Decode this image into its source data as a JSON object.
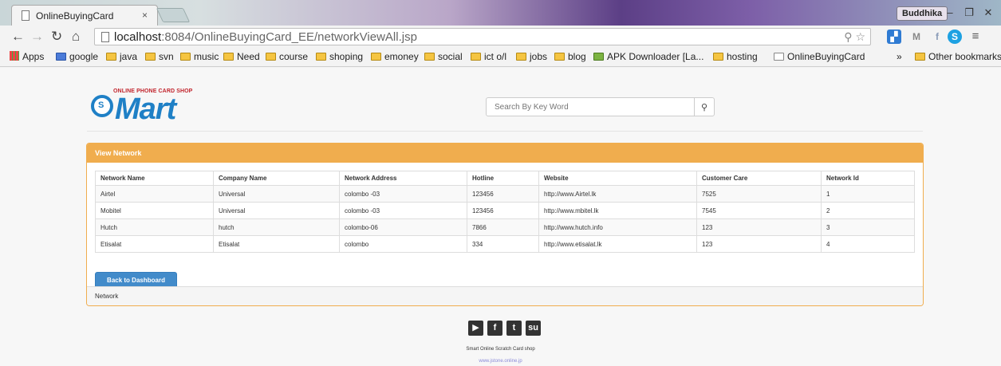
{
  "browser": {
    "tab_title": "OnlineBuyingCard",
    "tab_close": "×",
    "profile_name": "Buddhika",
    "url_host": "localhost",
    "url_rest": ":8084/OnlineBuyingCard_EE/networkViewAll.jsp",
    "bookmarks": [
      "Apps",
      "google",
      "java",
      "svn",
      "music",
      "Need",
      "course",
      "shoping",
      "emoney",
      "social",
      "ict o/l",
      "jobs",
      "blog",
      "APK Downloader [La...",
      "hosting",
      "OnlineBuyingCard"
    ],
    "bookmarks_more": "»",
    "other_bookmarks": "Other bookmarks"
  },
  "logo": {
    "tagline": "ONLINE PHONE CARD SHOP",
    "word": "Mart",
    "circle_letter": "S"
  },
  "search": {
    "placeholder": "Search By Key Word",
    "button_icon": "search-icon"
  },
  "panel": {
    "heading": "View Network",
    "columns": [
      "Network Name",
      "Company Name",
      "Network Address",
      "Hotline",
      "Website",
      "Customer Care",
      "Network Id"
    ],
    "rows": [
      [
        "Airtel",
        "Universal",
        "colombo -03",
        "123456",
        "http://www.Airtel.lk",
        "7525",
        "1"
      ],
      [
        "Mobitel",
        "Universal",
        "colombo -03",
        "123456",
        "http://www.mbitel.lk",
        "7545",
        "2"
      ],
      [
        "Hutch",
        "hutch",
        "colombo-06",
        "7866",
        "http://www.hutch.info",
        "123",
        "3"
      ],
      [
        "Etisalat",
        "Etisalat",
        "colombo",
        "334",
        "http://www.etisalat.lk",
        "123",
        "4"
      ]
    ],
    "back_button": "Back to Dashboard",
    "footer": "Network"
  },
  "footer": {
    "social_icons": [
      "youtube-icon",
      "facebook-icon",
      "twitter-icon",
      "stumbleupon-icon"
    ],
    "tagline": "Smart Online Scratch Card shop",
    "site": "www.jstone.online.jp"
  },
  "colors": {
    "panel_accent": "#f0ad4e",
    "button_primary": "#428bca",
    "logo_blue": "#1f80c6"
  }
}
